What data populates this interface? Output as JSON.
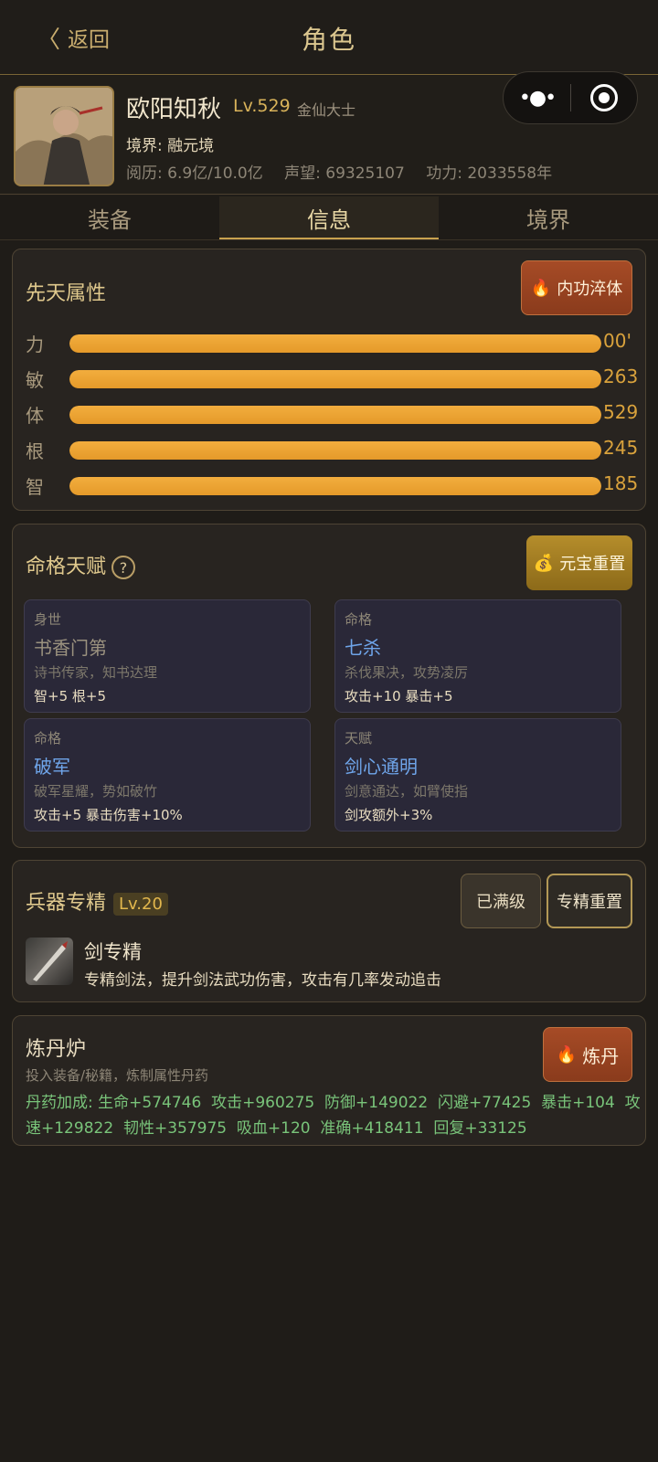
{
  "header": {
    "back_label": "返回",
    "title": "角色"
  },
  "capsule": {
    "more_icon": "more-dots-icon",
    "close_icon": "target-circle-icon"
  },
  "profile": {
    "name": "欧阳知秋",
    "level": "Lv.529",
    "rank": "金仙大士",
    "realm": "境界: 融元境",
    "experience": "阅历: 6.9亿/10.0亿",
    "reputation": "声望: 69325107",
    "power": "功力: 2033558年"
  },
  "tabs": [
    "装备",
    "信息",
    "境界"
  ],
  "active_tab": "信息",
  "innate": {
    "title": "先天属性",
    "button_label": "内功淬体",
    "attributes": [
      {
        "label": "力",
        "value": "'00",
        "fill": 1.0
      },
      {
        "label": "敏",
        "value": "263",
        "fill": 1.0
      },
      {
        "label": "体",
        "value": "529",
        "fill": 1.0
      },
      {
        "label": "根",
        "value": "245",
        "fill": 1.0
      },
      {
        "label": "智",
        "value": "185",
        "fill": 1.0
      }
    ]
  },
  "talent": {
    "title": "命格天赋",
    "help": "?",
    "button_label": "元宝重置",
    "cards": [
      {
        "category": "身世",
        "name": "书香门第",
        "desc": "诗书传家，知书达理",
        "bonus": "智+5 根+5",
        "highlight": false
      },
      {
        "category": "命格",
        "name": "七杀",
        "desc": "杀伐果决，攻势凌厉",
        "bonus": "攻击+10 暴击+5",
        "highlight": true
      },
      {
        "category": "命格",
        "name": "破军",
        "desc": "破军星耀，势如破竹",
        "bonus": "攻击+5 暴击伤害+10%",
        "highlight": true
      },
      {
        "category": "天赋",
        "name": "剑心通明",
        "desc": "剑意通达，如臂使指",
        "bonus": "剑攻额外+3%",
        "highlight": true
      }
    ]
  },
  "weapon": {
    "title": "兵器专精",
    "level": "Lv.20",
    "maxed_label": "已满级",
    "reset_label": "专精重置",
    "name": "剑专精",
    "desc": "专精剑法，提升剑法武功伤害，攻击有几率发动追击"
  },
  "alchemy": {
    "title": "炼丹炉",
    "subtitle": "投入装备/秘籍，炼制属性丹药",
    "button_label": "炼丹",
    "bonus_line1": "丹药加成: 生命+574746  攻击+960275  防御+149022  闪避+77425  暴击+104  攻",
    "bonus_line2": "速+129822  韧性+357975  吸血+120  准确+418411  回复+33125"
  }
}
